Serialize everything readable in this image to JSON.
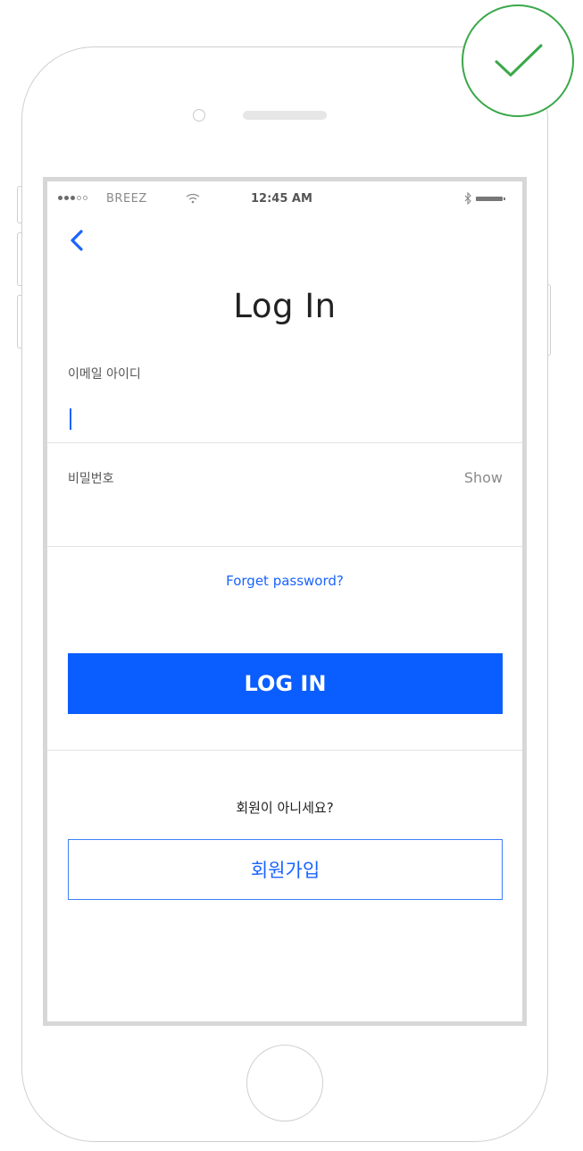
{
  "badge": {
    "icon": "checkmark-icon",
    "color": "#3aa84a"
  },
  "status_bar": {
    "carrier": "BREEZ",
    "time": "12:45 AM",
    "icons": [
      "signal-dots-icon",
      "wifi-icon",
      "bluetooth-icon",
      "battery-icon"
    ]
  },
  "nav": {
    "back_icon": "chevron-left-icon"
  },
  "login_form": {
    "title": "Log In",
    "email_label": "이메일 아이디",
    "email_value": "",
    "password_label": "비밀번호",
    "password_value": "",
    "show_label": "Show",
    "forgot_label": "Forget password?",
    "submit_label": "LOG IN"
  },
  "signup": {
    "prompt": "회원이 아니세요?",
    "button_label": "회원가입"
  },
  "colors": {
    "primary": "#0a5dff",
    "link": "#1a63ff",
    "check": "#3aa84a"
  }
}
